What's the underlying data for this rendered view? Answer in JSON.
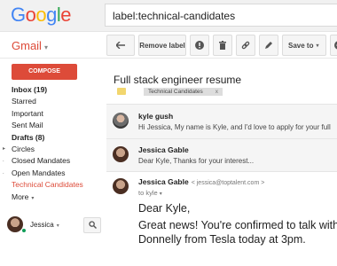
{
  "header": {
    "logo_letters": [
      {
        "char": "G",
        "color": "#4285f4"
      },
      {
        "char": "o",
        "color": "#ea4335"
      },
      {
        "char": "o",
        "color": "#fbbc05"
      },
      {
        "char": "g",
        "color": "#4285f4"
      },
      {
        "char": "l",
        "color": "#34a853"
      },
      {
        "char": "e",
        "color": "#ea4335"
      }
    ],
    "search_value": "label:technical-candidates"
  },
  "app": {
    "label": "Gmail",
    "caret": "▾"
  },
  "toolbar": {
    "remove_label": "Remove label",
    "save_to": "Save to",
    "back_icon": "arrow-back-icon",
    "report_icon": "report-spam-icon",
    "delete_icon": "trash-icon",
    "link_icon": "link-icon",
    "edit_icon": "pencil-icon",
    "more_icon": "more-icon"
  },
  "sidebar": {
    "compose": "COMPOSE",
    "items": [
      {
        "label": "Inbox (19)",
        "bold": true
      },
      {
        "label": "Starred"
      },
      {
        "label": "Important"
      },
      {
        "label": "Sent Mail"
      },
      {
        "label": "Drafts (8)",
        "bold": true
      },
      {
        "label": "Circles",
        "arrow": "▸"
      },
      {
        "label": "Closed Mandates",
        "arrow": "."
      },
      {
        "label": "Open Mandates",
        "arrow": "."
      },
      {
        "label": "Technical Candidates",
        "active": true
      },
      {
        "label": "More",
        "caret": "▾"
      }
    ],
    "user": {
      "name": "Jessica",
      "caret": "▾"
    }
  },
  "thread": {
    "subject": "Full stack engineer resume",
    "label_chip": "Technical Candidates",
    "label_close": "x",
    "messages": [
      {
        "sender": "kyle gush",
        "snippet": "Hi Jessica, My name is Kyle, and I'd love to apply for your full"
      },
      {
        "sender": "Jessica Gable",
        "snippet": "Dear Kyle, Thanks for your interest..."
      },
      {
        "sender": "Jessica Gable",
        "email": "< jessica@toptalent.com >",
        "to": "to kyle",
        "to_caret": "▾",
        "body": [
          "Dear Kyle,",
          "Great news! You're confirmed to talk with",
          "Donnelly from Tesla today at 3pm."
        ]
      }
    ]
  },
  "colors": {
    "accent_red": "#dd4b39",
    "header_bg": "#f1f1f1",
    "online": "#0f9d58"
  }
}
